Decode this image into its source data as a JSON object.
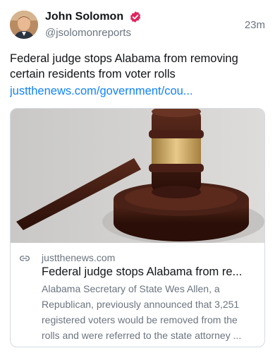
{
  "author": {
    "name": "John Solomon",
    "handle": "@jsolomonreports",
    "verified_color": "#e0245e"
  },
  "timestamp": "23m",
  "post": {
    "text": "Federal judge stops Alabama from removing certain residents from voter rolls",
    "link_text": "justthenews.com/government/cou..."
  },
  "link_card": {
    "domain": "justthenews.com",
    "title": "Federal judge stops Alabama from re...",
    "description": "Alabama Secretary of State Wes Allen, a Republican, previously announced that 3,251 registered voters would be removed from the rolls and were referred to the state attorney ...",
    "icon": "link-icon"
  },
  "colors": {
    "link": "#1083fe",
    "muted": "#6b7580",
    "border": "#d4dbe2"
  }
}
